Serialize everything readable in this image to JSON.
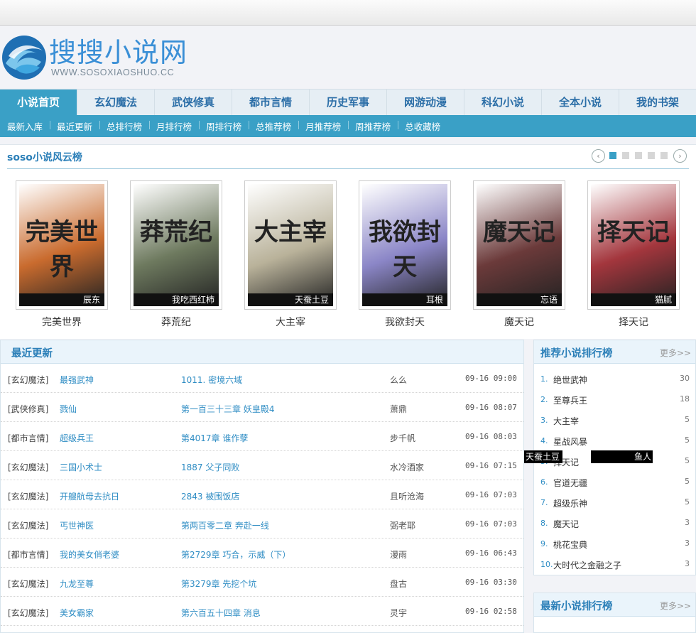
{
  "site": {
    "title": "搜搜小说网",
    "url": "WWW.SOSOXIAOSHUO.CC"
  },
  "main_nav": [
    {
      "label": "小说首页"
    },
    {
      "label": "玄幻魔法"
    },
    {
      "label": "武侠修真"
    },
    {
      "label": "都市言情"
    },
    {
      "label": "历史军事"
    },
    {
      "label": "网游动漫"
    },
    {
      "label": "科幻小说"
    },
    {
      "label": "全本小说"
    },
    {
      "label": "我的书架"
    }
  ],
  "sub_nav": [
    {
      "label": "最新入库"
    },
    {
      "label": "最近更新"
    },
    {
      "label": "总排行榜"
    },
    {
      "label": "月排行榜"
    },
    {
      "label": "周排行榜"
    },
    {
      "label": "总推荐榜"
    },
    {
      "label": "月推荐榜"
    },
    {
      "label": "周推荐榜"
    },
    {
      "label": "总收藏榜"
    }
  ],
  "hot": {
    "title": "soso小说风云榜",
    "prev": "‹",
    "next": "›",
    "books": [
      {
        "name": "完美世界",
        "author": "辰东",
        "cover_text": "完美世界",
        "bg": "#c96b2e"
      },
      {
        "name": "莽荒纪",
        "author": "我吃西红柿",
        "cover_text": "莽荒纪",
        "bg": "#6e7a5f"
      },
      {
        "name": "大主宰",
        "author": "天蚕土豆",
        "cover_text": "大主宰",
        "bg": "#b9b29a"
      },
      {
        "name": "我欲封天",
        "author": "耳根",
        "cover_text": "我欲封天",
        "bg": "#8b86c7"
      },
      {
        "name": "魔天记",
        "author": "忘语",
        "cover_text": "魔天记",
        "bg": "#6b3a3a"
      },
      {
        "name": "择天记",
        "author": "猫腻",
        "cover_text": "择天记",
        "bg": "#a3363d"
      }
    ]
  },
  "recent": {
    "title": "最近更新",
    "rows": [
      {
        "cat": "[玄幻魔法]",
        "name": "最强武神",
        "chapter": "1011. 密境六域",
        "author": "么么",
        "time": "09-16 09:00"
      },
      {
        "cat": "[武侠修真]",
        "name": "戮仙",
        "chapter": "第一百三十三章 妖皇殿4",
        "author": "萧鼎",
        "time": "09-16 08:07"
      },
      {
        "cat": "[都市言情]",
        "name": "超级兵王",
        "chapter": "第4017章 谁作孽",
        "author": "步千帆",
        "time": "09-16 08:03"
      },
      {
        "cat": "[玄幻魔法]",
        "name": "三国小术士",
        "chapter": "1887 父子同败",
        "author": "水冷酒家",
        "time": "09-16 07:15"
      },
      {
        "cat": "[玄幻魔法]",
        "name": "开艘航母去抗日",
        "chapter": "2843 被围饭店",
        "author": "且听沧海",
        "time": "09-16 07:03"
      },
      {
        "cat": "[玄幻魔法]",
        "name": "丐世神医",
        "chapter": "第两百零二章 奔赴一线",
        "author": "弼老耶",
        "time": "09-16 07:03"
      },
      {
        "cat": "[都市言情]",
        "name": "我的美女俏老婆",
        "chapter": "第2729章 巧合，示威（下）",
        "author": "漫雨",
        "time": "09-16 06:43"
      },
      {
        "cat": "[玄幻魔法]",
        "name": "九龙至尊",
        "chapter": "第3279章 先挖个坑",
        "author": "盘古",
        "time": "09-16 03:30"
      },
      {
        "cat": "[玄幻魔法]",
        "name": "美女霸家",
        "chapter": "第六百五十四章 消息",
        "author": "灵宇",
        "time": "09-16 02:58"
      }
    ]
  },
  "recommend": {
    "title": "推荐小说排行榜",
    "more": "更多>>",
    "items": [
      {
        "no": "1.",
        "name": "绝世武神",
        "count": "30"
      },
      {
        "no": "2.",
        "name": "至尊兵王",
        "count": "18"
      },
      {
        "no": "3.",
        "name": "大主宰",
        "count": "5"
      },
      {
        "no": "4.",
        "name": "星战风暴",
        "count": "5"
      },
      {
        "no": "5.",
        "name": "择天记",
        "count": "5"
      },
      {
        "no": "6.",
        "name": "官道无疆",
        "count": "5"
      },
      {
        "no": "7.",
        "name": "超级乐神",
        "count": "5"
      },
      {
        "no": "8.",
        "name": "魔天记",
        "count": "3"
      },
      {
        "no": "9.",
        "name": "桃花宝典",
        "count": "3"
      },
      {
        "no": "10.",
        "name": "大时代之金融之子",
        "count": "3"
      }
    ]
  },
  "newest": {
    "title": "最新小说排行榜",
    "more": "更多>>"
  },
  "stray_labels": {
    "a": "天蚕土豆",
    "b": "鱼人"
  }
}
